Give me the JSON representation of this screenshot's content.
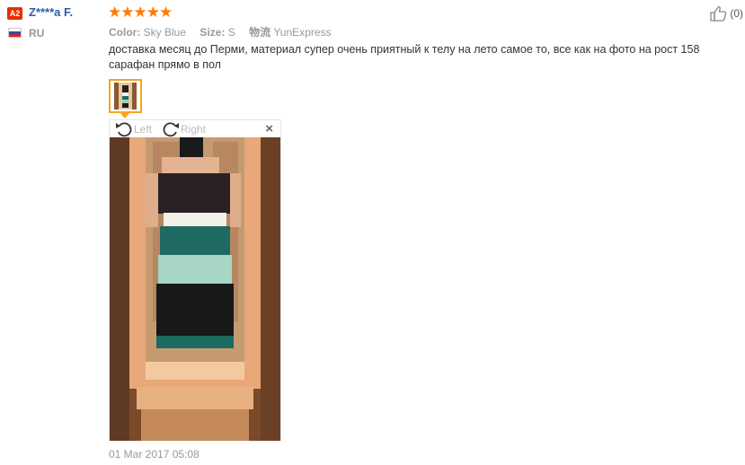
{
  "user": {
    "level": "A2",
    "name": "Z****a F.",
    "country": "RU",
    "flag_colors": [
      "#ffffff",
      "#2a4fb0",
      "#d22"
    ]
  },
  "rating": {
    "stars": 5,
    "max": 5,
    "color": "#ff7b00"
  },
  "attributes": [
    {
      "key": "Color:",
      "value": "Sky Blue"
    },
    {
      "key": "Size:",
      "value": "S"
    },
    {
      "key": "物流",
      "value": "YunExpress"
    }
  ],
  "like": {
    "icon": "thumbs-up-icon",
    "count": "(0)"
  },
  "review": {
    "text": "доставка месяц до Перми, материал супер очень приятный к телу на лето самое то, все как на фото на рост 158 сарафан прямо в пол",
    "date": "01 Mar 2017 05:08"
  },
  "viewer": {
    "rotate_left": "Left",
    "rotate_right": "Right",
    "close": "×"
  },
  "colors": {
    "accent": "#f5a623",
    "name": "#2a5ca8",
    "badge": "#e62e04"
  }
}
